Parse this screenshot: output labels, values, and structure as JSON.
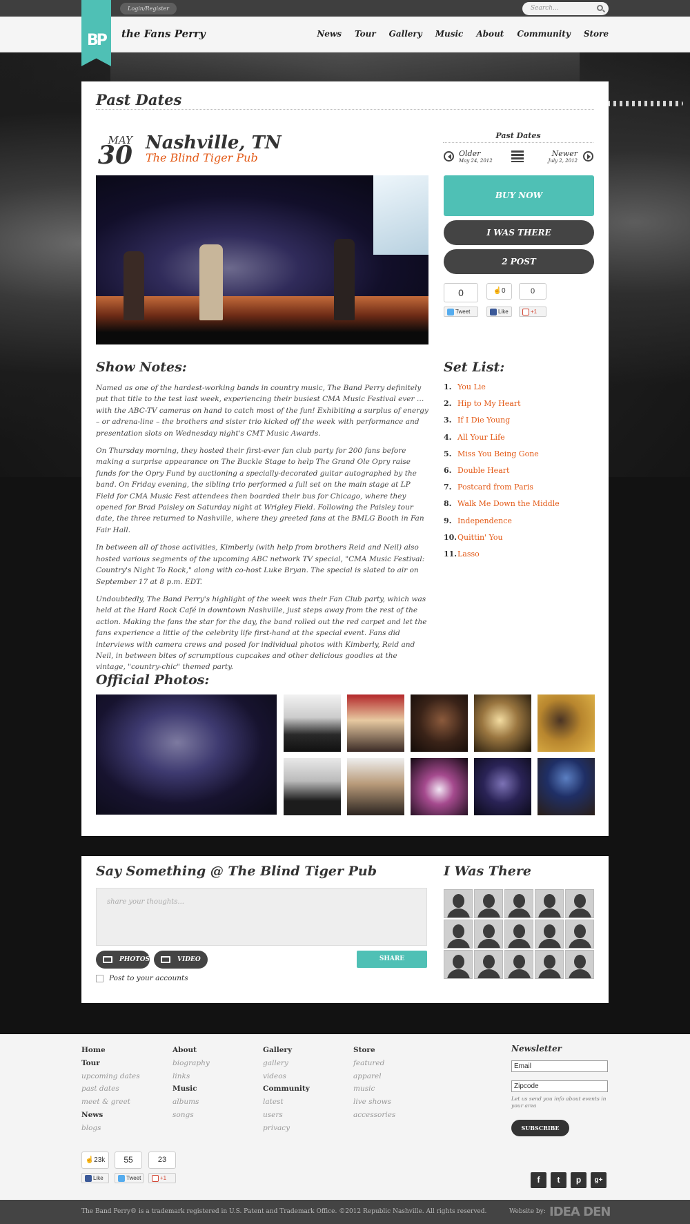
{
  "topbar": {
    "login_label": "Login/Register",
    "search_placeholder": "Search..."
  },
  "header": {
    "brand": "the Fans Perry",
    "logo_text": "BP",
    "nav": [
      "News",
      "Tour",
      "Gallery",
      "Music",
      "About",
      "Community",
      "Store"
    ]
  },
  "page": {
    "title": "Past Dates",
    "date_month": "MAY",
    "date_day": "30",
    "city": "Nashville, TN",
    "venue": "The Blind Tiger Pub"
  },
  "sidebar": {
    "past_dates_title": "Past Dates",
    "older_label": "Older",
    "older_date": "May 24, 2012",
    "newer_label": "Newer",
    "newer_date": "July 2, 2012",
    "buy_now": "BUY NOW",
    "i_was_there": "I WAS THERE",
    "post_button": "2 POST",
    "tweet_count": "0",
    "like_count": "0",
    "plus_count": "0",
    "tweet_label": "Tweet",
    "like_label": "Like",
    "plus_label": "+1"
  },
  "show_notes": {
    "heading": "Show Notes:",
    "paragraphs": [
      "Named as one of the hardest-working bands in country music, The Band Perry definitely put that title to the test last week, experiencing their busiest CMA Music Festival ever … with the ABC-TV cameras on hand to catch most of the fun! Exhibiting a surplus of energy – or adrena-line – the brothers and sister trio kicked off the week with performance and presentation slots on Wednesday night's CMT Music Awards.",
      "On Thursday morning, they hosted their first-ever fan club party for 200 fans before making a surprise appearance on The Buckle Stage to help The Grand Ole Opry raise funds for the Opry Fund by auctioning a specially-decorated guitar autographed by the band. On Friday evening, the sibling trio performed a full set on the main stage at LP Field for CMA Music Fest attendees then boarded their bus for Chicago, where they opened for Brad Paisley on Saturday night at Wrigley Field. Following the Paisley tour date, the three returned to Nashville, where they greeted fans at the BMLG Booth in Fan Fair Hall.",
      "In between all of those activities, Kimberly (with help from brothers Reid and Neil) also hosted various segments of the upcoming ABC network TV special, \"CMA Music Festival: Country's Night To Rock,\" along with co-host Luke Bryan. The special is slated to air on September 17 at 8 p.m. EDT.",
      "Undoubtedly, The Band Perry's highlight of the week was their Fan Club party, which was held at the Hard Rock Café in downtown Nashville, just steps away from the rest of the action. Making the fans the star for the day, the band rolled out the red carpet and let the fans experience a little of the celebrity life first-hand at the special event. Fans did interviews with camera crews and posed for individual photos with Kimberly, Reid and Neil, in between bites of scrumptious cupcakes and other delicious goodies at the vintage, \"country-chic\" themed party."
    ]
  },
  "setlist": {
    "heading": "Set List:",
    "songs": [
      {
        "num": "1.",
        "title": "You Lie"
      },
      {
        "num": "2.",
        "title": "Hip to My Heart"
      },
      {
        "num": "3.",
        "title": "If I Die Young"
      },
      {
        "num": "4.",
        "title": "All Your Life"
      },
      {
        "num": "5.",
        "title": "Miss You Being Gone"
      },
      {
        "num": "6.",
        "title": "Double Heart"
      },
      {
        "num": "7.",
        "title": "Postcard from Paris"
      },
      {
        "num": "8.",
        "title": "Walk Me Down the Middle"
      },
      {
        "num": "9.",
        "title": "Independence"
      },
      {
        "num": "10.",
        "title": "Quittin' You"
      },
      {
        "num": "11.",
        "title": "Lasso"
      }
    ]
  },
  "photos": {
    "heading": "Official Photos:"
  },
  "comments": {
    "heading": "Say Something @ The Blind Tiger Pub",
    "placeholder": "share your thoughts...",
    "photos_btn": "PHOTOS",
    "video_btn": "VIDEO",
    "share_btn": "SHARE",
    "post_accounts": "Post to your accounts",
    "was_there_heading": "I Was There"
  },
  "footer": {
    "col1": [
      {
        "text": "Home",
        "head": true
      },
      {
        "text": "Tour",
        "head": true
      },
      {
        "text": "upcoming dates",
        "head": false
      },
      {
        "text": "past dates",
        "head": false
      },
      {
        "text": "meet & greet",
        "head": false
      },
      {
        "text": "News",
        "head": true
      },
      {
        "text": "blogs",
        "head": false
      }
    ],
    "col2": [
      {
        "text": "About",
        "head": true
      },
      {
        "text": "biography",
        "head": false
      },
      {
        "text": "links",
        "head": false
      },
      {
        "text": "Music",
        "head": true
      },
      {
        "text": "albums",
        "head": false
      },
      {
        "text": "songs",
        "head": false
      }
    ],
    "col3": [
      {
        "text": "Gallery",
        "head": true
      },
      {
        "text": "gallery",
        "head": false
      },
      {
        "text": "videos",
        "head": false
      },
      {
        "text": "Community",
        "head": true
      },
      {
        "text": "latest",
        "head": false
      },
      {
        "text": "users",
        "head": false
      },
      {
        "text": "privacy",
        "head": false
      }
    ],
    "col4": [
      {
        "text": "Store",
        "head": true
      },
      {
        "text": "featured",
        "head": false
      },
      {
        "text": "apparel",
        "head": false
      },
      {
        "text": "music",
        "head": false
      },
      {
        "text": "live shows",
        "head": false
      },
      {
        "text": "accessories",
        "head": false
      }
    ],
    "newsletter_title": "Newsletter",
    "email_placeholder": "Email",
    "zip_placeholder": "Zipcode",
    "newsletter_note": "Let us send you info about events in your area",
    "subscribe": "SUBSCRIBE",
    "like_count": "23k",
    "tweet_count": "55",
    "plus_count": "23",
    "like_label": "Like",
    "tweet_label": "Tweet",
    "plus_label": "+1",
    "social_icons": [
      "f",
      "t",
      "p",
      "g+"
    ],
    "copyright": "The Band Perry® is a trademark registered in U.S. Patent and Trademark Office. ©2012 Republic Nashville. All rights reserved.",
    "website_by": "Website by:",
    "agency": "IDEA DEN"
  },
  "colors": {
    "accent": "#4fc0b5",
    "link": "#e35a17",
    "dark": "#444444"
  }
}
